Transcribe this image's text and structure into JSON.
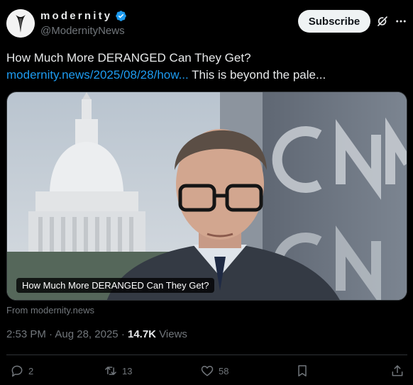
{
  "author": {
    "display_name": "modernity",
    "handle": "@ModernityNews"
  },
  "header": {
    "subscribe_label": "Subscribe"
  },
  "tweet": {
    "text": "How Much More DERANGED Can They Get?",
    "link": "modernity.news/2025/08/28/how...",
    "text_after_link": " This is beyond the pale..."
  },
  "media": {
    "caption": "How Much More DERANGED Can They Get?",
    "source": "From modernity.news"
  },
  "meta": {
    "time": "2:53 PM",
    "separator": "·",
    "date": "Aug 28, 2025",
    "views_count": "14.7K",
    "views_label": "Views"
  },
  "actions": {
    "replies": "2",
    "reposts": "13",
    "likes": "58"
  },
  "colors": {
    "background": "#000000",
    "text": "#e7e9ea",
    "secondary": "#71767b",
    "link": "#1d9bf0",
    "verified": "#1d9bf0",
    "subscribe_bg": "#eff3f4"
  },
  "icons": [
    "avatar-logo",
    "verified-badge-icon",
    "grok-icon",
    "more-icon",
    "reply-icon",
    "repost-icon",
    "like-icon",
    "bookmark-icon",
    "share-icon"
  ]
}
